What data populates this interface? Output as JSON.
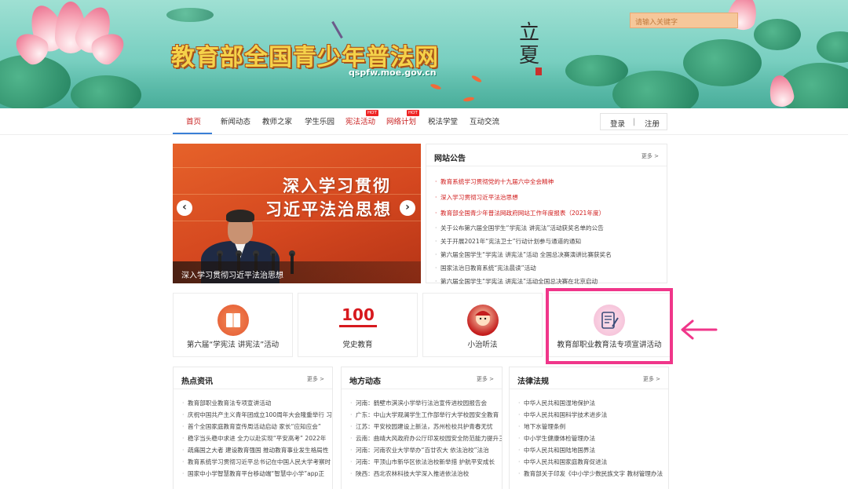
{
  "banner": {
    "title": "教育部全国青少年普法网",
    "url": "qspfw.moe.gov.cn",
    "solar_term": "立夏",
    "search_placeholder": "请输入关键字"
  },
  "nav": {
    "items": [
      {
        "label": "首页",
        "style": "active"
      },
      {
        "label": "新闻动态",
        "style": "normal"
      },
      {
        "label": "教师之家",
        "style": "normal"
      },
      {
        "label": "学生乐园",
        "style": "normal"
      },
      {
        "label": "宪法活动",
        "style": "red",
        "badge": "HOT"
      },
      {
        "label": "网络计划",
        "style": "red",
        "badge": "HOT"
      },
      {
        "label": "税法学堂",
        "style": "normal"
      },
      {
        "label": "互动交流",
        "style": "normal"
      }
    ],
    "login": "登录",
    "separator": "|",
    "register": "注册"
  },
  "carousel": {
    "line1": "深入学习贯彻",
    "line2": "习近平法治思想",
    "caption": "深入学习贯彻习近平法治思想",
    "prev": "‹",
    "next": "›"
  },
  "notice": {
    "title": "网站公告",
    "more": "更多 >",
    "items": [
      {
        "text": "教育系统学习贯彻党的十九届六中全会精神",
        "red": true
      },
      {
        "text": "深入学习贯彻习近平法治思想",
        "red": true
      },
      {
        "text": "教育部全国青少年普法网政府网站工作年度报表（2021年度）",
        "red": true
      },
      {
        "text": "关于公布第六届全国学生“学宪法 讲宪法”活动获奖名单的公告",
        "red": false
      },
      {
        "text": "关于开展2021年“宪法卫士”行动计划参与通道的通知",
        "red": false
      },
      {
        "text": "第六届全国学生“学宪法 讲宪法”活动 全国总决赛演讲比赛获奖名",
        "red": false
      },
      {
        "text": "国家法治日教育系统“宪法晨读”活动",
        "red": false
      },
      {
        "text": "第六届全国学生“学宪法 讲宪法”活动全国总决赛在北京启动",
        "red": false
      }
    ]
  },
  "cards": [
    {
      "label": "第六届“学宪法 讲宪法”活动",
      "icon": "book-icon"
    },
    {
      "label": "党史教育",
      "icon": "party-100-icon",
      "icon_text": "100"
    },
    {
      "label": "小治听法",
      "icon": "mascot-icon"
    },
    {
      "label": "教育部职业教育法专项宣讲活动",
      "icon": "document-pen-icon"
    }
  ],
  "hot": {
    "title": "热点资讯",
    "more": "更多 >",
    "items": [
      "教育部职业教育法专项宣讲活动",
      "庆祝中国共产主义青年团成立100周年大会隆重举行 习",
      "首个全国家庭教育宣传周活动启动 家长“应知应会”",
      "稳字当头稳中求进 全力以赴实现“平安高考” 2022年",
      "疏痛国之大者 建设教育强国 推动教育事业发生格局性",
      "教育系统学习贯彻习近平总书记在中国人民大学考察时",
      "国家中小学智慧教育平台移动端“智慧中小学”app正"
    ]
  },
  "local": {
    "title": "地方动态",
    "more": "更多 >",
    "items": [
      "河南：鹤壁市淇滨小学举行法治宣传进校园报告会",
      "广东：中山大学观澜学生工作部举行大学校园安全教育",
      "江苏：平安校园建设上新法，苏州检校共护青春无忧",
      "云南：曲靖大风政府办公厅印发校园安全防范能力提升三",
      "河南：河南农业大学举办“百廿农大 依法治校”法治",
      "河南：平顶山市新华区依法治校新举措 护航平安成长",
      "陕西：西北农林科技大学深入推进依法治校"
    ]
  },
  "law": {
    "title": "法律法规",
    "more": "更多 >",
    "items": [
      "中华人民共和国湿地保护法",
      "中华人民共和国科学技术进步法",
      "地下水管理条例",
      "中小学生健康体检管理办法",
      "中华人民共和国陆地国界法",
      "中华人民共和国家庭教育促进法",
      "教育部关于印发《中小学少数民族文字 教材管理办法"
    ]
  },
  "colors": {
    "accent_red": "#c81e1e",
    "highlight_pink": "#f0368a",
    "nav_active_blue": "#3a7fd6"
  }
}
